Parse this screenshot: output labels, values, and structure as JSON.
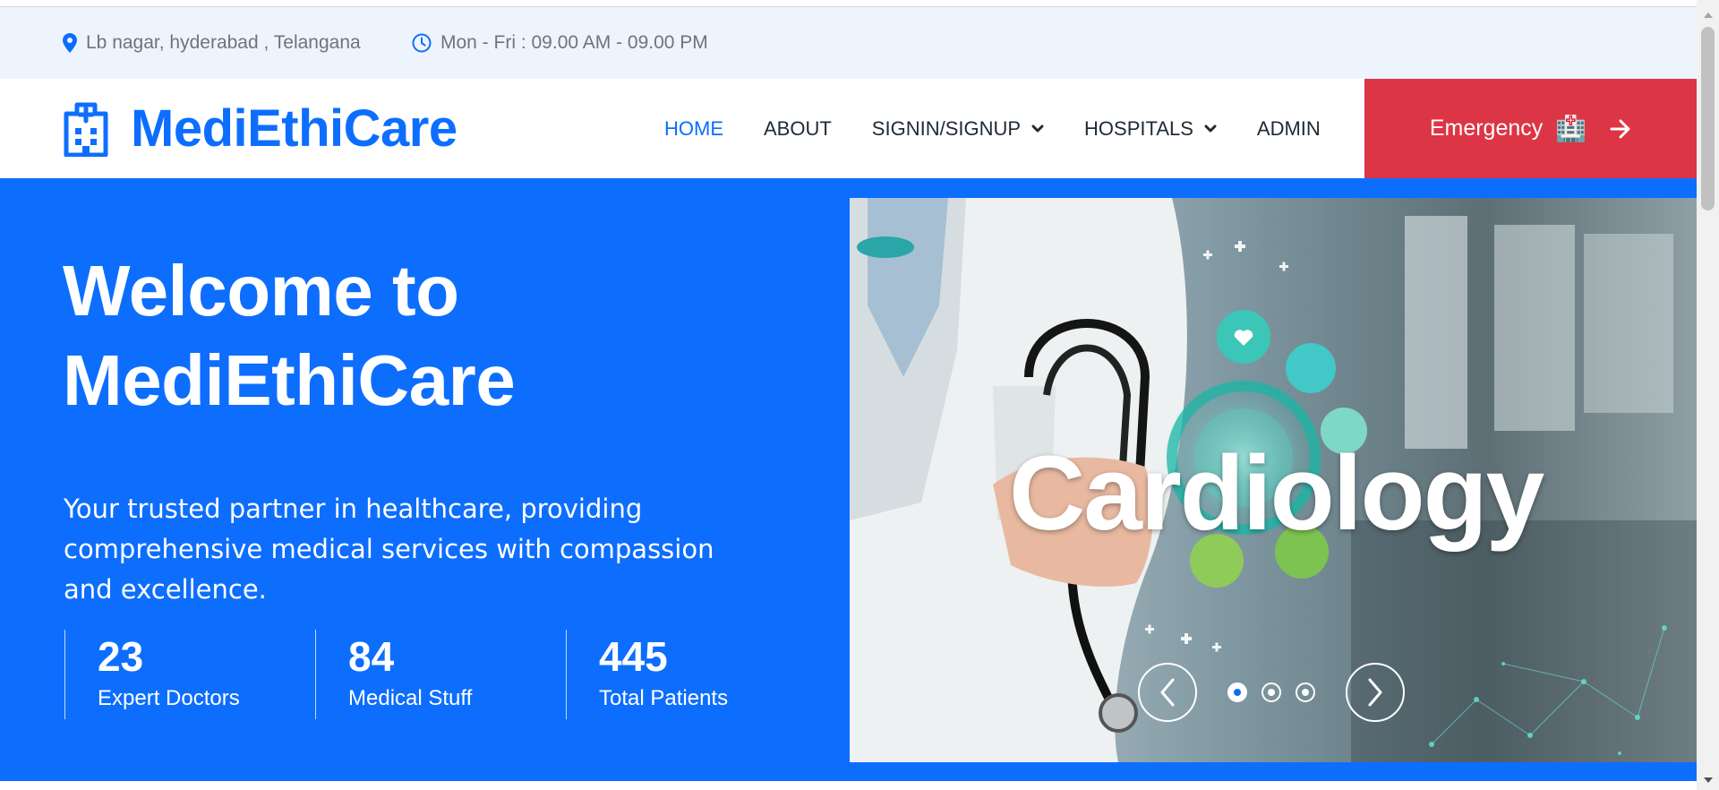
{
  "topbar": {
    "address": "Lb nagar, hyderabad , Telangana",
    "hours": "Mon - Fri : 09.00 AM - 09.00 PM"
  },
  "brand": {
    "name": "MediEthiCare",
    "icon": "hospital-icon"
  },
  "nav": {
    "items": [
      {
        "label": "HOME",
        "active": true,
        "dropdown": false
      },
      {
        "label": "ABOUT",
        "active": false,
        "dropdown": false
      },
      {
        "label": "SIGNIN/SIGNUP",
        "active": false,
        "dropdown": true
      },
      {
        "label": "HOSPITALS",
        "active": false,
        "dropdown": true
      },
      {
        "label": "ADMIN",
        "active": false,
        "dropdown": false
      }
    ],
    "emergency_label": "Emergency",
    "emergency_emoji": "🏥"
  },
  "hero": {
    "title_line1": "Welcome to",
    "title_line2": "MediEthiCare",
    "description": "Your trusted partner in healthcare, providing comprehensive medical services with compassion and excellence.",
    "stats": [
      {
        "value": "23",
        "label": "Expert Doctors"
      },
      {
        "value": "84",
        "label": "Medical Stuff"
      },
      {
        "value": "445",
        "label": "Total Patients"
      }
    ]
  },
  "carousel": {
    "caption": "Cardiology",
    "slide_count": 3,
    "active_index": 0
  },
  "colors": {
    "primary": "#0d6efd",
    "danger": "#dc3545",
    "topbar_bg": "#eef4fd",
    "muted_text": "#6c757d"
  }
}
